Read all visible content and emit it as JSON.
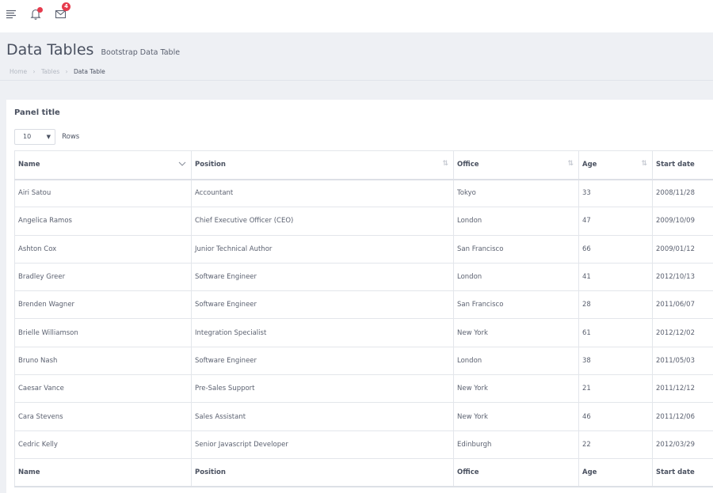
{
  "topbar": {
    "menu_icon": "hamburger-icon",
    "bell_icon": "bell-icon",
    "mail_icon": "envelope-icon",
    "mail_badge": "4",
    "accent_color": "#e63b4d"
  },
  "header": {
    "title": "Data Tables",
    "subtitle": "Bootstrap Data Table",
    "breadcrumb": [
      "Home",
      "Tables",
      "Data Table"
    ]
  },
  "panel": {
    "title": "Panel title",
    "rows_select_value": "10",
    "rows_label": "Rows"
  },
  "table": {
    "columns": [
      "Name",
      "Position",
      "Office",
      "Age",
      "Start date"
    ],
    "rows": [
      [
        "Airi Satou",
        "Accountant",
        "Tokyo",
        "33",
        "2008/11/28"
      ],
      [
        "Angelica Ramos",
        "Chief Executive Officer (CEO)",
        "London",
        "47",
        "2009/10/09"
      ],
      [
        "Ashton Cox",
        "Junior Technical Author",
        "San Francisco",
        "66",
        "2009/01/12"
      ],
      [
        "Bradley Greer",
        "Software Engineer",
        "London",
        "41",
        "2012/10/13"
      ],
      [
        "Brenden Wagner",
        "Software Engineer",
        "San Francisco",
        "28",
        "2011/06/07"
      ],
      [
        "Brielle Williamson",
        "Integration Specialist",
        "New York",
        "61",
        "2012/12/02"
      ],
      [
        "Bruno Nash",
        "Software Engineer",
        "London",
        "38",
        "2011/05/03"
      ],
      [
        "Caesar Vance",
        "Pre-Sales Support",
        "New York",
        "21",
        "2011/12/12"
      ],
      [
        "Cara Stevens",
        "Sales Assistant",
        "New York",
        "46",
        "2011/12/06"
      ],
      [
        "Cedric Kelly",
        "Senior Javascript Developer",
        "Edinburgh",
        "22",
        "2012/03/29"
      ]
    ]
  }
}
